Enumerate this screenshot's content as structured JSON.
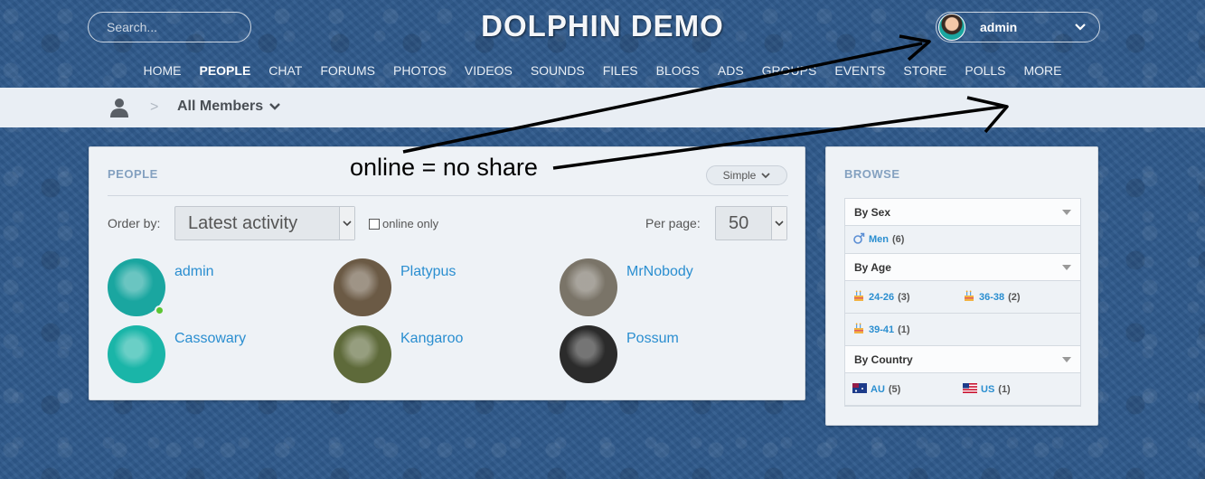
{
  "header": {
    "search_placeholder": "Search...",
    "site_title": "DOLPHIN DEMO",
    "user_name": "admin"
  },
  "nav": [
    {
      "label": "HOME",
      "active": false
    },
    {
      "label": "PEOPLE",
      "active": true
    },
    {
      "label": "CHAT",
      "active": false
    },
    {
      "label": "FORUMS",
      "active": false
    },
    {
      "label": "PHOTOS",
      "active": false
    },
    {
      "label": "VIDEOS",
      "active": false
    },
    {
      "label": "SOUNDS",
      "active": false
    },
    {
      "label": "FILES",
      "active": false
    },
    {
      "label": "BLOGS",
      "active": false
    },
    {
      "label": "ADS",
      "active": false
    },
    {
      "label": "GROUPS",
      "active": false
    },
    {
      "label": "EVENTS",
      "active": false
    },
    {
      "label": "STORE",
      "active": false
    },
    {
      "label": "POLLS",
      "active": false
    },
    {
      "label": "MORE",
      "active": false
    }
  ],
  "breadcrumb": {
    "separator": ">",
    "current": "All Members"
  },
  "people": {
    "title": "PEOPLE",
    "view_mode": "Simple",
    "order_label": "Order by:",
    "order_value": "Latest activity",
    "online_only_label": "online only",
    "online_only_checked": false,
    "per_page_label": "Per page:",
    "per_page_value": "50",
    "members": [
      {
        "name": "admin",
        "online": true,
        "avatar_color": "#1aa6a0"
      },
      {
        "name": "Platypus",
        "online": false,
        "avatar_color": "#6b5a45"
      },
      {
        "name": "MrNobody",
        "online": false,
        "avatar_color": "#7a7468"
      },
      {
        "name": "Cassowary",
        "online": false,
        "avatar_color": "#1ab5a8"
      },
      {
        "name": "Kangaroo",
        "online": false,
        "avatar_color": "#5e6a3a"
      },
      {
        "name": "Possum",
        "online": false,
        "avatar_color": "#2b2b2b"
      }
    ]
  },
  "browse": {
    "title": "BROWSE",
    "sections": [
      {
        "heading": "By Sex",
        "rows": [
          [
            {
              "label": "Men",
              "count": "(6)",
              "icon": "male-icon"
            }
          ]
        ]
      },
      {
        "heading": "By Age",
        "rows": [
          [
            {
              "label": "24-26",
              "count": "(3)",
              "icon": "cake-icon"
            },
            {
              "label": "36-38",
              "count": "(2)",
              "icon": "cake-icon"
            }
          ],
          [
            {
              "label": "39-41",
              "count": "(1)",
              "icon": "cake-icon"
            }
          ]
        ]
      },
      {
        "heading": "By Country",
        "rows": [
          [
            {
              "label": "AU",
              "count": "(5)",
              "icon": "flag-au-icon"
            },
            {
              "label": "US",
              "count": "(1)",
              "icon": "flag-us-icon"
            }
          ]
        ]
      }
    ]
  },
  "annotation": {
    "text": "online = no share"
  },
  "colors": {
    "accent_link": "#2a8ed0",
    "panel_title": "#84a1c0",
    "online": "#5cc633"
  }
}
